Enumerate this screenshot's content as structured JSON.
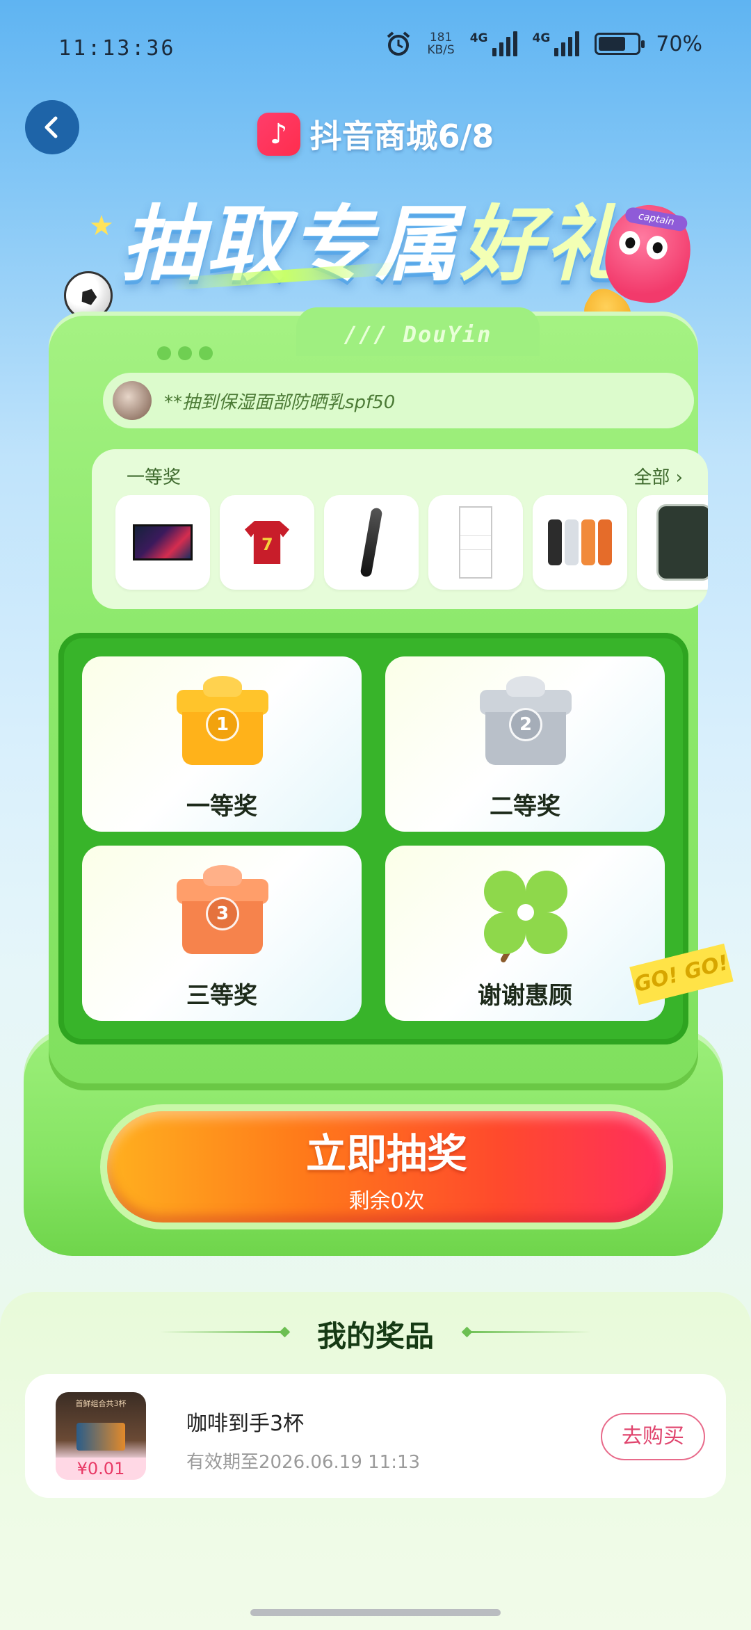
{
  "status_bar": {
    "time": "11:13:36",
    "net_speed_value": "181",
    "net_speed_unit": "KB/S",
    "signal1_label": "4G",
    "signal2_label": "4G",
    "battery_percent": "70%",
    "battery_level": 0.7
  },
  "header": {
    "brand_name": "抖音商城6/8",
    "brand_logo_glyph": "♪",
    "headline_part1": "抽取专属",
    "headline_part2": "好礼",
    "mascot_band": "captain"
  },
  "machine": {
    "tab_label": "/// DouYin",
    "winner_text": "**抽到保湿面部防晒乳spf50",
    "prize_tier_label": "一等奖",
    "view_all_label": "全部",
    "prize_thumbs": [
      "tv-icon",
      "jersey-icon",
      "hair-styler-icon",
      "fridge-icon",
      "phones-icon",
      "phone-icon"
    ],
    "cells": [
      {
        "label": "一等奖",
        "medal": "1",
        "icon": "gold-gift-icon"
      },
      {
        "label": "二等奖",
        "medal": "2",
        "icon": "silver-gift-icon"
      },
      {
        "label": "三等奖",
        "medal": "3",
        "icon": "bronze-gift-icon"
      },
      {
        "label": "谢谢惠顾",
        "icon": "clover-icon"
      }
    ],
    "go_tag": "GO! GO!",
    "draw_button": {
      "main": "立即抽奖",
      "sub": "剩余0次"
    }
  },
  "my_prizes": {
    "title": "我的奖品",
    "items": [
      {
        "name": "咖啡到手3杯",
        "expiry": "有效期至2026.06.19 11:13",
        "price": "¥0.01",
        "image_caption": "首鲜组合共3杯",
        "action": "去购买"
      }
    ]
  },
  "colors": {
    "accent_green": "#38b42a",
    "draw_button_start": "#ffb01f",
    "draw_button_end": "#ff2d5e",
    "buy_button": "#e0456e",
    "back_button": "#1e64a8"
  }
}
